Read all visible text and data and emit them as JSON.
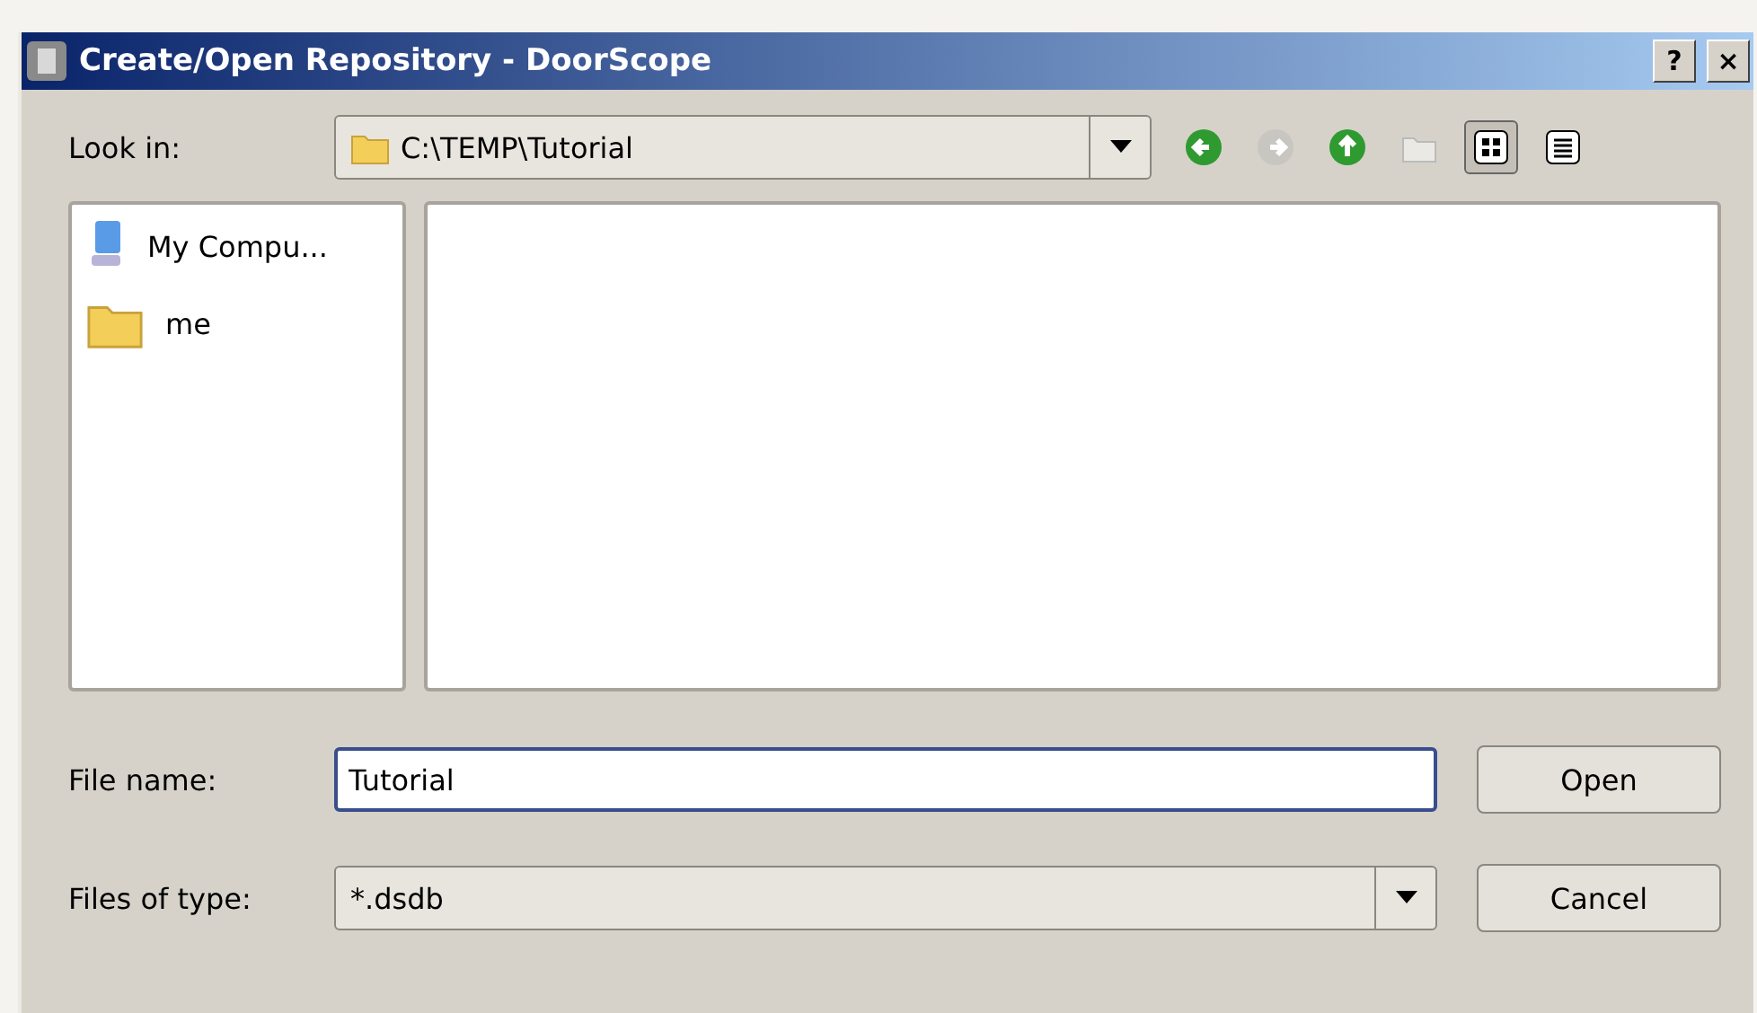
{
  "window": {
    "title": "Create/Open Repository - DoorScope",
    "buttons": [
      "?",
      "×"
    ]
  },
  "look_in": {
    "label": "Look in:",
    "value": "C:\\TEMP\\Tutorial"
  },
  "toolbar": [
    {
      "kind": "back",
      "disabled": false,
      "selected": false
    },
    {
      "kind": "forward",
      "disabled": true,
      "selected": false
    },
    {
      "kind": "up",
      "disabled": false,
      "selected": false
    },
    {
      "kind": "new-folder",
      "disabled": true,
      "selected": false
    },
    {
      "kind": "icon-view",
      "disabled": false,
      "selected": true
    },
    {
      "kind": "detail-view",
      "disabled": false,
      "selected": false
    }
  ],
  "sidebar": {
    "items": [
      {
        "kind": "computer",
        "label": "My Compu..."
      },
      {
        "kind": "folder",
        "label": "me"
      }
    ]
  },
  "file_name": {
    "label": "File name:",
    "value": "Tutorial"
  },
  "file_type": {
    "label": "Files of type:",
    "value": "*.dsdb"
  },
  "buttons": [
    "Open",
    "Cancel"
  ]
}
